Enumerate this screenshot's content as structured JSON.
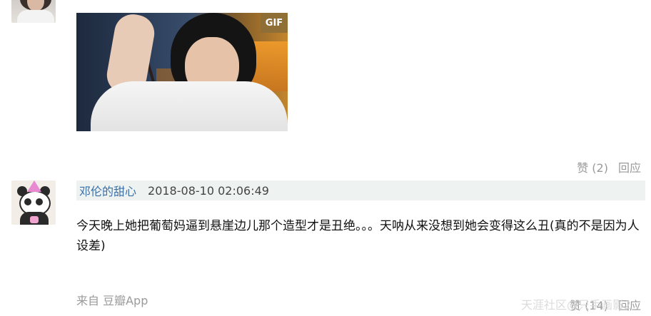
{
  "prev_post": {
    "gif_badge": "GIF",
    "like_label": "赞 (2)",
    "reply_label": "回应"
  },
  "comment": {
    "username": "邓伦的甜心",
    "timestamp": "2018-08-10 02:06:49",
    "text": "今天晚上她把葡萄妈逼到悬崖边儿那个造型才是丑绝。。。天呐从来没想到她会变得这么丑(真的不是因为人设差)",
    "source": "来自 豆瓣App",
    "like_label": "赞 (14)",
    "reply_label": "回应"
  },
  "watermark": "天涯社区@只手画影2"
}
